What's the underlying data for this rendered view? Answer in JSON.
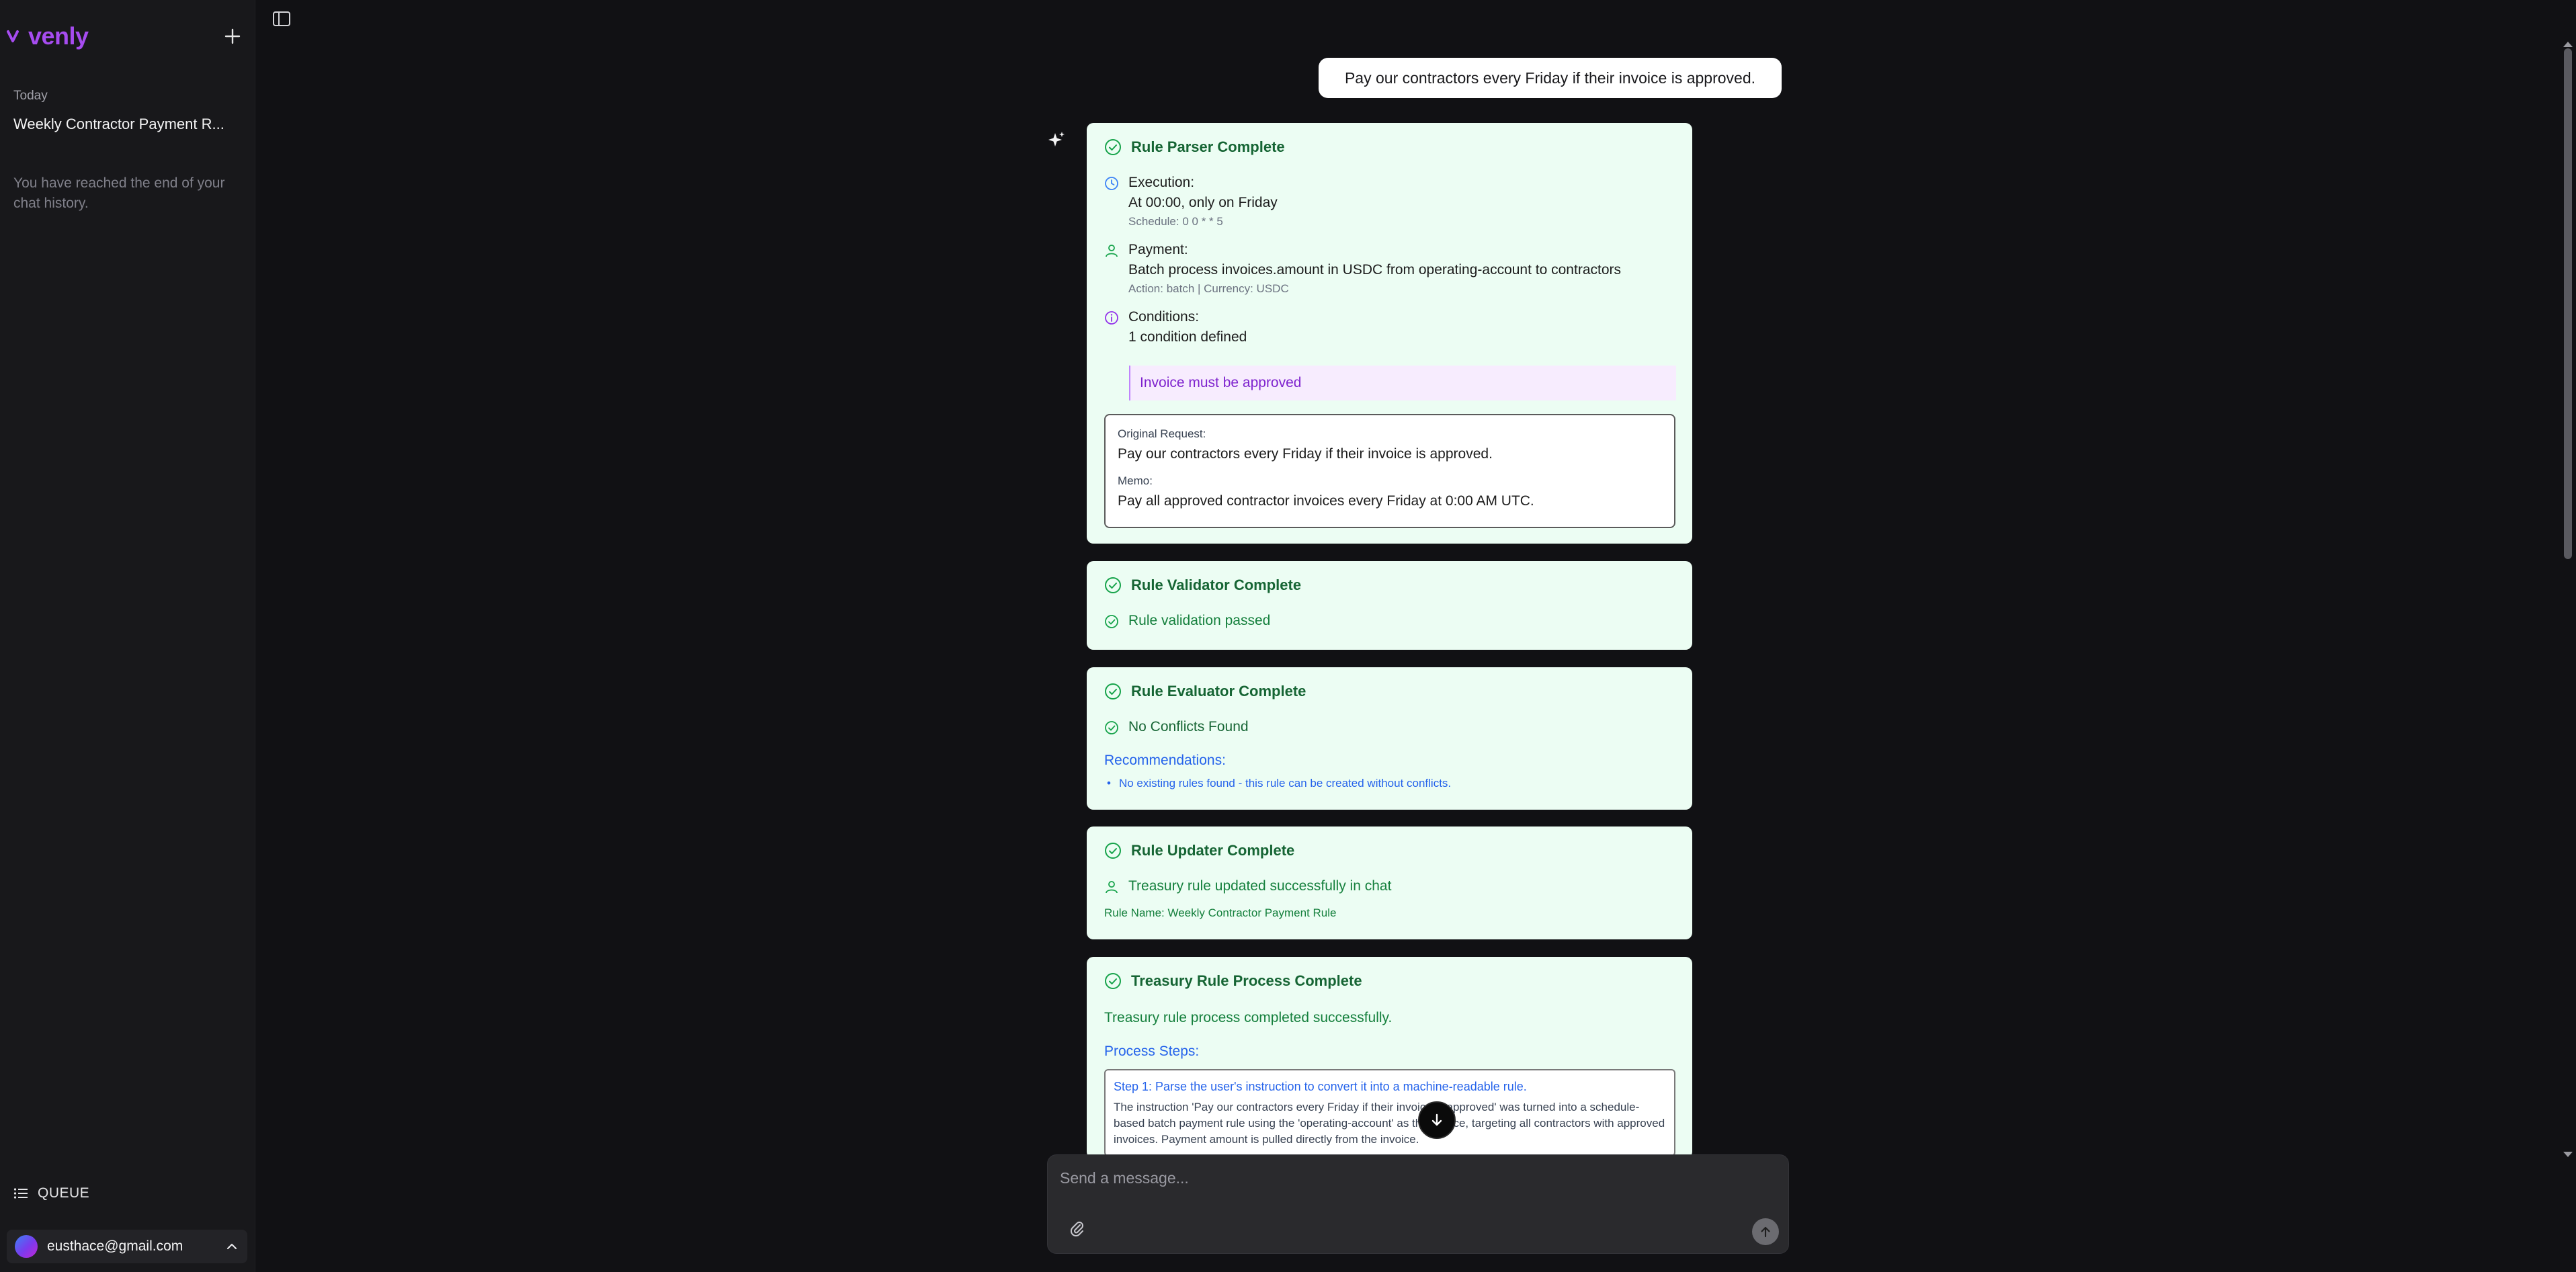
{
  "sidebar": {
    "logo_text": "venly",
    "section_today": "Today",
    "history": [
      {
        "title": "Weekly Contractor Payment R..."
      }
    ],
    "end_note": "You have reached the end of your chat history.",
    "queue_label": "QUEUE",
    "user_email": "eusthace@gmail.com"
  },
  "chat": {
    "user_message": "Pay our contractors every Friday if their invoice is approved.",
    "parser": {
      "title": "Rule Parser Complete",
      "execution_label": "Execution:",
      "execution_value": "At 00:00, only on Friday",
      "schedule": "Schedule: 0 0 * * 5",
      "payment_label": "Payment:",
      "payment_value": "Batch process invoices.amount in USDC from operating-account to contractors",
      "payment_meta": "Action: batch | Currency: USDC",
      "conditions_label": "Conditions:",
      "conditions_value": "1 condition defined",
      "condition_item": "Invoice must be approved",
      "original_request_label": "Original Request:",
      "original_request": "Pay our contractors every Friday if their invoice is approved.",
      "memo_label": "Memo:",
      "memo": "Pay all approved contractor invoices every Friday at 0:00 AM UTC."
    },
    "validator": {
      "title": "Rule Validator Complete",
      "status": "Rule validation passed"
    },
    "evaluator": {
      "title": "Rule Evaluator Complete",
      "status": "No Conflicts Found",
      "recommendations_label": "Recommendations:",
      "recommendations": [
        "No existing rules found - this rule can be created without conflicts."
      ]
    },
    "updater": {
      "title": "Rule Updater Complete",
      "status": "Treasury rule updated successfully in chat",
      "rule_name": "Rule Name: Weekly Contractor Payment Rule"
    },
    "process": {
      "title": "Treasury Rule Process Complete",
      "status": "Treasury rule process completed successfully.",
      "steps_label": "Process Steps:",
      "steps": [
        {
          "title": "Step 1: Parse the user's instruction to convert it into a machine-readable rule.",
          "desc": "The instruction 'Pay our contractors every Friday if their invoice is approved' was turned into a schedule-based batch payment rule using the 'operating-account' as the source, targeting all contractors with approved invoices. Payment amount is pulled directly from the invoice."
        }
      ]
    }
  },
  "composer": {
    "placeholder": "Send a message..."
  },
  "colors": {
    "brand": "#a64cf0",
    "success": "#15803d",
    "card_bg": "#ecfdf3",
    "link_blue": "#2563eb",
    "condition_purple": "#7e22ce"
  }
}
